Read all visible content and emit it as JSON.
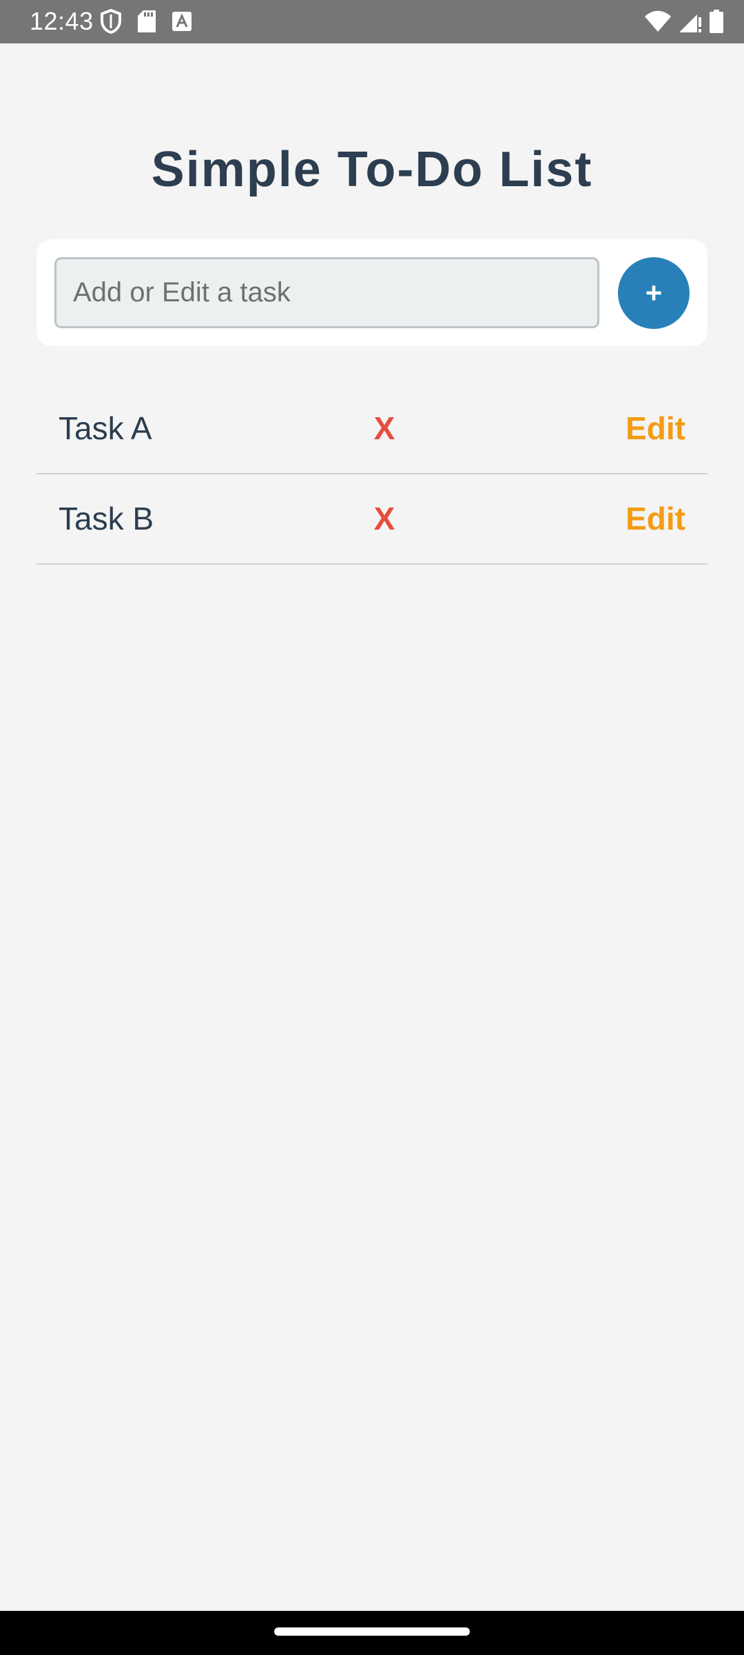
{
  "status_bar": {
    "time": "12:43",
    "left_icons": [
      "shield-icon",
      "sd-card-icon",
      "text-a-icon"
    ],
    "right_icons": [
      "wifi-icon",
      "cellular-signal-icon",
      "battery-icon"
    ]
  },
  "header": {
    "title": "Simple To-Do List"
  },
  "input_card": {
    "placeholder": "Add or Edit a task",
    "value": "",
    "add_label": "+"
  },
  "tasks": [
    {
      "text": "Task A",
      "delete_label": "X",
      "edit_label": "Edit"
    },
    {
      "text": "Task B",
      "delete_label": "X",
      "edit_label": "Edit"
    }
  ],
  "colors": {
    "background": "#f4f4f4",
    "title": "#2c3e50",
    "accent": "#2980b9",
    "delete": "#e74c3c",
    "edit": "#f39c12",
    "input_bg": "#ecf0f1",
    "input_border": "#bdc3c7"
  }
}
